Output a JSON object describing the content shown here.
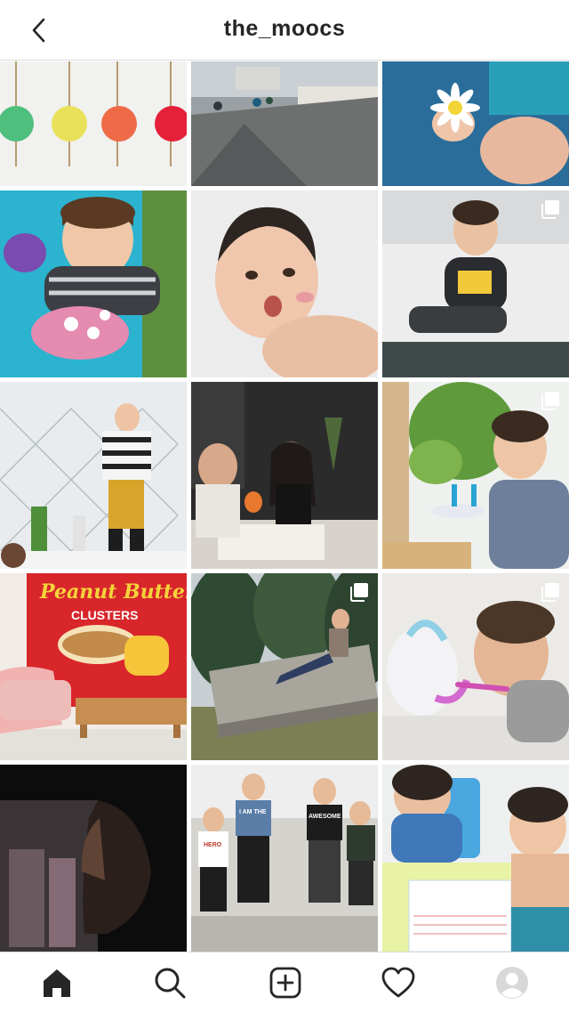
{
  "header": {
    "title": "the_moocs",
    "back_icon": "chevron-left-icon"
  },
  "posts": [
    {
      "label": "crochet ornaments",
      "multi": false
    },
    {
      "label": "seaside promenade",
      "multi": false
    },
    {
      "label": "daisy in hand",
      "multi": false
    },
    {
      "label": "child on picnic blanket",
      "multi": false
    },
    {
      "label": "smiling baby",
      "multi": false
    },
    {
      "label": "toddler on bed",
      "multi": true
    },
    {
      "label": "boy at window",
      "multi": false
    },
    {
      "label": "family at table",
      "multi": false
    },
    {
      "label": "boy with birthday cake",
      "multi": true
    },
    {
      "label": "peanut butter clusters poster",
      "multi": false
    },
    {
      "label": "boy on log",
      "multi": true
    },
    {
      "label": "boy with unicorn toy",
      "multi": true
    },
    {
      "label": "child silhouette",
      "multi": false
    },
    {
      "label": "kids walking",
      "multi": false
    },
    {
      "label": "boys drawing",
      "multi": false
    }
  ],
  "poster_text": {
    "line1": "Peanut Butter",
    "line2": "CLUSTERS"
  },
  "shirt_text": {
    "kid1": "HERO",
    "kid2": "I AM THE",
    "kid3": "AWESOME"
  },
  "tabbar": {
    "items": [
      {
        "name": "tab-home",
        "icon": "home-icon",
        "active": true
      },
      {
        "name": "tab-search",
        "icon": "search-icon",
        "active": false
      },
      {
        "name": "tab-new-post",
        "icon": "plus-square-icon",
        "active": false
      },
      {
        "name": "tab-activity",
        "icon": "heart-icon",
        "active": false
      },
      {
        "name": "tab-profile",
        "icon": "avatar-icon",
        "active": false
      }
    ]
  },
  "colors": {
    "text": "#262626",
    "divider": "#dbdbdb",
    "background": "#ffffff"
  }
}
